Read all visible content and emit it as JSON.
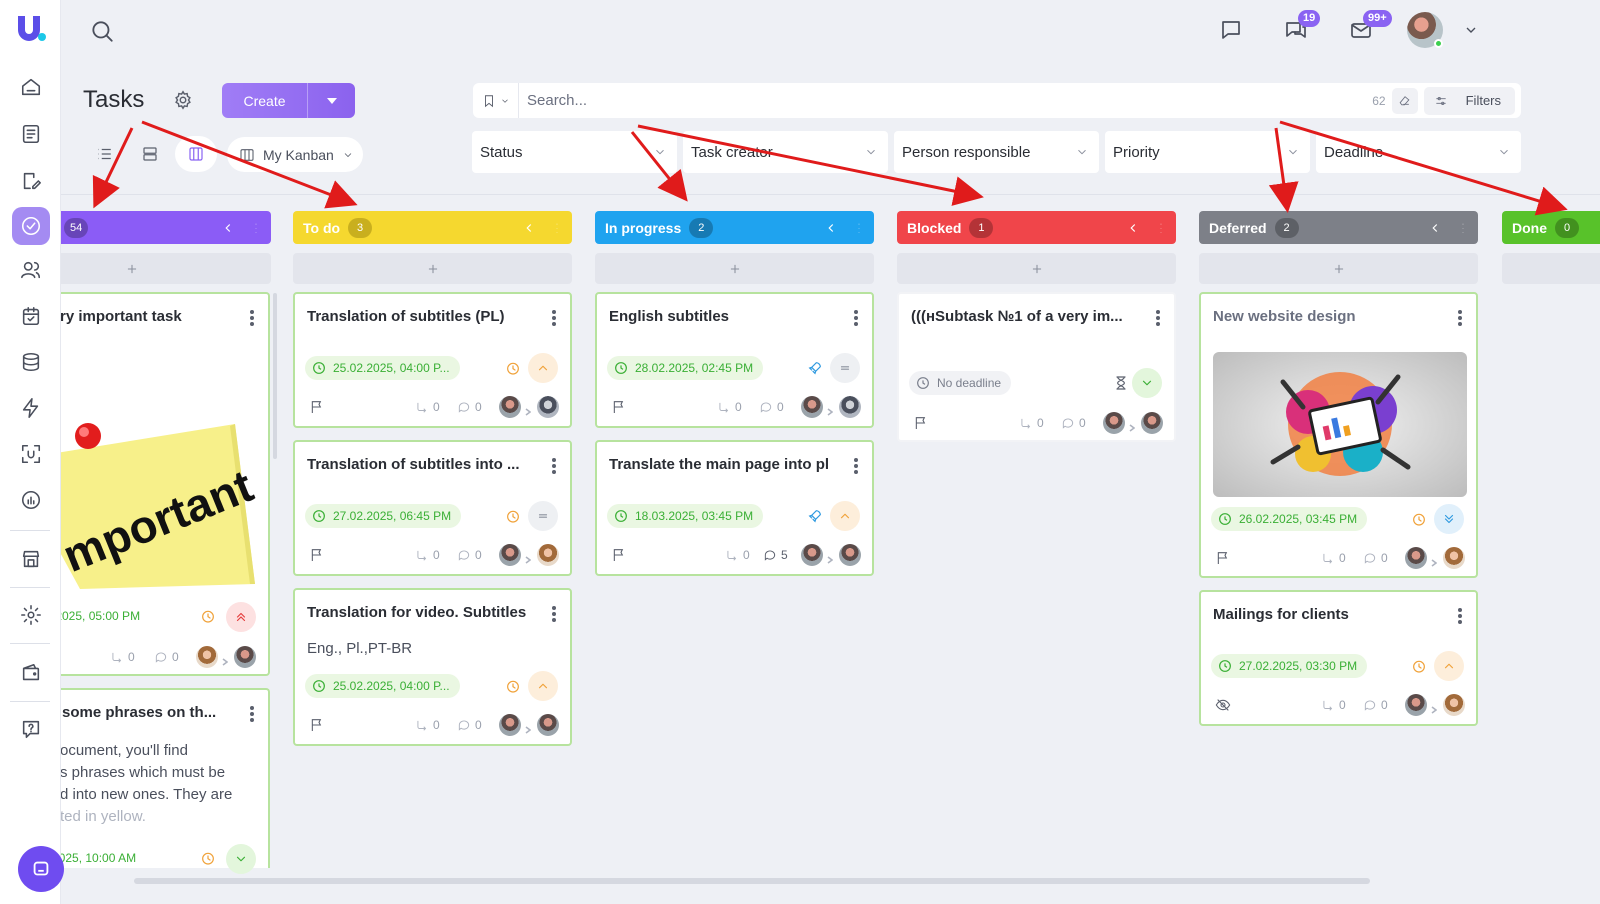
{
  "app": {
    "title": "Tasks"
  },
  "topbar": {
    "chat_badge": "19",
    "mail_badge": "99+"
  },
  "header": {
    "create_label": "Create",
    "kanban_label": "My Kanban",
    "search_placeholder": "Search...",
    "search_count": "62",
    "filters_label": "Filters",
    "filters": [
      "Status",
      "Task creator",
      "Person responsible",
      "Priority",
      "Deadline"
    ]
  },
  "columns": [
    {
      "label": "",
      "count": "54",
      "color": "#8b5cf6"
    },
    {
      "label": "To do",
      "count": "3",
      "color": "#f5d82f"
    },
    {
      "label": "In progress",
      "count": "2",
      "color": "#1fa3ef"
    },
    {
      "label": "Blocked",
      "count": "1",
      "color": "#f0454a"
    },
    {
      "label": "Deferred",
      "count": "2",
      "color": "#7d8088"
    },
    {
      "label": "Done",
      "count": "0",
      "color": "#58c22a"
    }
  ],
  "cards": {
    "c0a": {
      "title": "ry important task",
      "date": ".2025, 05:00 PM",
      "subtasks": "0",
      "comments": "0",
      "image_text": "mportant"
    },
    "c0b": {
      "title": "some phrases on th...",
      "desc1": "ocument, you'll find",
      "desc2": "s phrases which must be",
      "desc3": "d into new ones. They are",
      "desc4": "ted in yellow.",
      "date": "2025, 10:00 AM"
    },
    "c1a": {
      "title": "Translation of subtitles (PL)",
      "date": "25.02.2025, 04:00 P...",
      "subtasks": "0",
      "comments": "0"
    },
    "c1b": {
      "title": "Translation of subtitles into ...",
      "date": "27.02.2025, 06:45 PM",
      "subtasks": "0",
      "comments": "0"
    },
    "c1c": {
      "title": "Translation for video. Subtitles",
      "desc": "Eng., Pl.,PT-BR",
      "date": "25.02.2025, 04:00 P...",
      "subtasks": "0",
      "comments": "0"
    },
    "c2a": {
      "title": "English subtitles",
      "date": "28.02.2025, 02:45 PM",
      "subtasks": "0",
      "comments": "0"
    },
    "c2b": {
      "title": "Translate the main page into pl",
      "date": "18.03.2025, 03:45 PM",
      "subtasks": "0",
      "comments": "5"
    },
    "c3a": {
      "title": "(((нSubtask №1 of a very im...",
      "date": "No deadline",
      "subtasks": "0",
      "comments": "0"
    },
    "c4a": {
      "title": "New website design",
      "date": "26.02.2025, 03:45 PM",
      "subtasks": "0",
      "comments": "0"
    },
    "c4b": {
      "title": "Mailings for clients",
      "date": "27.02.2025, 03:30 PM",
      "subtasks": "0",
      "comments": "0"
    }
  },
  "colors": {
    "accent": "#8a63f2",
    "card_border": "#b7e39e",
    "annotation": "#e01b1b"
  }
}
